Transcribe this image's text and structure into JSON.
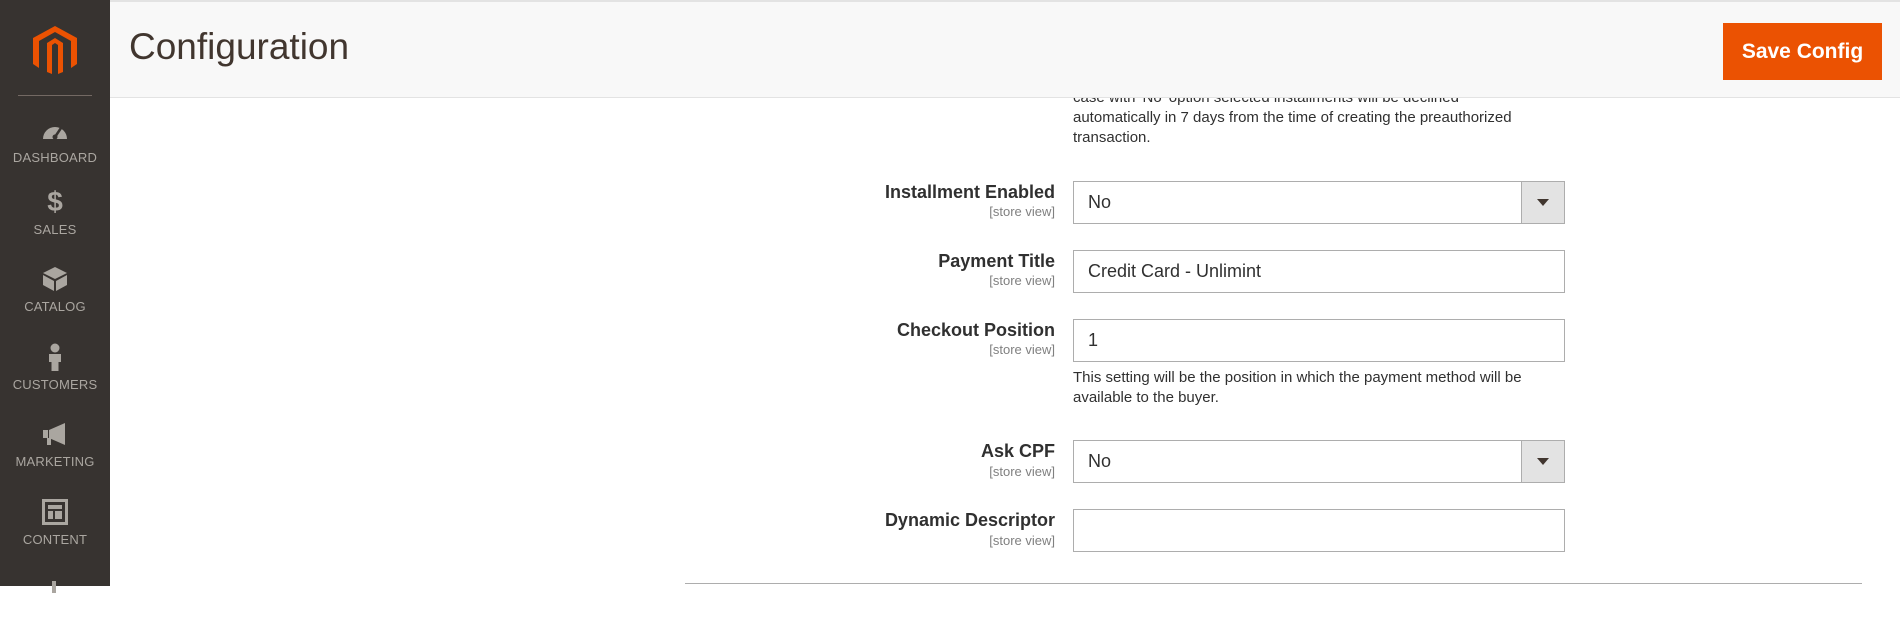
{
  "header": {
    "title": "Configuration",
    "save_label": "Save Config"
  },
  "sidebar": {
    "items": [
      {
        "label": "DASHBOARD",
        "icon": "dashboard-gauge-icon"
      },
      {
        "label": "SALES",
        "icon": "dollar-icon"
      },
      {
        "label": "CATALOG",
        "icon": "box-icon"
      },
      {
        "label": "CUSTOMERS",
        "icon": "person-icon"
      },
      {
        "label": "MARKETING",
        "icon": "megaphone-icon"
      },
      {
        "label": "CONTENT",
        "icon": "layout-icon"
      }
    ]
  },
  "form": {
    "top_note": {
      "line1": "case with 'No' option selected installments will be declined",
      "line2": "automatically in 7 days from the time of creating the preauthorized",
      "line3": "transaction."
    },
    "fields": [
      {
        "label": "Installment Enabled",
        "scope": "[store view]",
        "type": "select",
        "value": "No"
      },
      {
        "label": "Payment Title",
        "scope": "[store view]",
        "type": "text",
        "value": "Credit Card - Unlimint"
      },
      {
        "label": "Checkout Position",
        "scope": "[store view]",
        "type": "text",
        "value": "1",
        "note_line1": "This setting will be the position in which the payment method will be",
        "note_line2": "available to the buyer."
      },
      {
        "label": "Ask CPF",
        "scope": "[store view]",
        "type": "select",
        "value": "No"
      },
      {
        "label": "Dynamic Descriptor",
        "scope": "[store view]",
        "type": "text",
        "value": ""
      }
    ]
  },
  "colors": {
    "sidebar_bg": "#373330",
    "accent": "#eb5202",
    "header_bg": "#f8f8f8"
  }
}
